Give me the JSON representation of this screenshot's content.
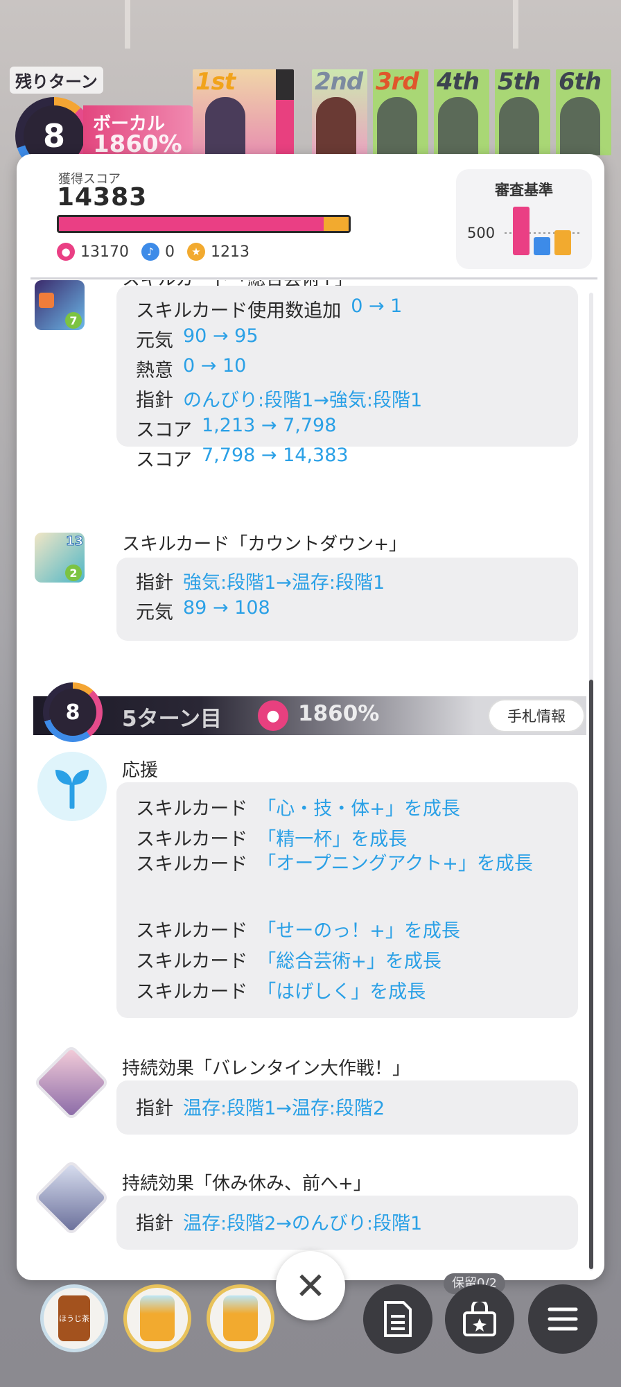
{
  "hud": {
    "remaining_turns_label": "残りターン",
    "remaining_turns": "8",
    "vocal_label": "ボーカル",
    "vocal_value": "1860%",
    "ranks": [
      "1st",
      "2nd",
      "3rd",
      "4th",
      "5th",
      "6th"
    ]
  },
  "score": {
    "label": "獲得スコア",
    "value": "14383",
    "vocal_part": "13170",
    "dance_part": "0",
    "visual_part": "1213",
    "bar_pink_fraction": 0.915,
    "bar_orange_fraction": 0.085
  },
  "criteria": {
    "title": "審査基準",
    "threshold": "500"
  },
  "entries": {
    "e1": {
      "title": "スキルカード「総合芸術+」",
      "badge": "7",
      "rows": [
        {
          "k": "スキルカード使用数追加",
          "v": "0 → 1"
        },
        {
          "k": "元気",
          "v": "90 → 95"
        },
        {
          "k": "熱意",
          "v": "0 → 10"
        },
        {
          "k": "指針",
          "v": "のんびり:段階1→強気:段階1"
        },
        {
          "k": "スコア",
          "v": "1,213 → 7,798"
        },
        {
          "k": "スコア",
          "v": "7,798 → 14,383"
        }
      ]
    },
    "e2": {
      "title": "スキルカード「カウントダウン+」",
      "badge_top": "13",
      "badge": "2",
      "rows": [
        {
          "k": "指針",
          "v": "強気:段階1→温存:段階1"
        },
        {
          "k": "元気",
          "v": "89 → 108"
        }
      ]
    },
    "turn": {
      "ring": "8",
      "label": "5ターン目",
      "percent": "1860%",
      "hand_info": "手札情報"
    },
    "e3": {
      "title": "応援",
      "rows": [
        {
          "k": "スキルカード",
          "v": "「心・技・体+」を成長"
        },
        {
          "k": "スキルカード",
          "v": "「精一杯」を成長"
        },
        {
          "k": "スキルカード",
          "v": "「オープニングアクト+」を成長"
        },
        {
          "k": "スキルカード",
          "v": "「せーのっ！+」を成長"
        },
        {
          "k": "スキルカード",
          "v": "「総合芸術+」を成長"
        },
        {
          "k": "スキルカード",
          "v": "「はげしく」を成長"
        }
      ]
    },
    "e4": {
      "title": "持続効果「バレンタイン大作戦！」",
      "rows": [
        {
          "k": "指針",
          "v": "温存:段階1→温存:段階2"
        }
      ]
    },
    "e5": {
      "title": "持続効果「休み休み、前へ+」",
      "rows": [
        {
          "k": "指針",
          "v": "温存:段階2→のんびり:段階1"
        }
      ]
    }
  },
  "bottom": {
    "close_glyph": "✕",
    "item1_label": "ほうじ茶",
    "hold_label": "保留0/2"
  },
  "colors": {
    "accent_blue": "#2aa0e6",
    "vocal_pink": "#ea3f84",
    "visual_orange": "#f2aa2f",
    "dance_blue": "#3d8be8"
  },
  "icons": [
    "mic-icon",
    "shoe-icon",
    "star-icon",
    "sprout-icon",
    "close-icon",
    "memo-icon",
    "gift-icon",
    "menu-icon"
  ]
}
